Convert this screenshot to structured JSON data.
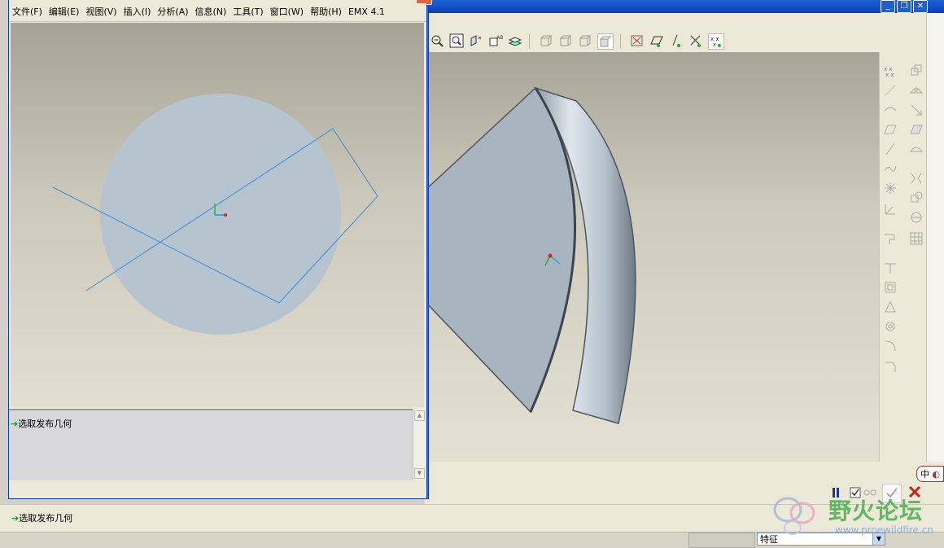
{
  "front_window": {
    "menu": [
      {
        "label": "文件(F)"
      },
      {
        "label": "编辑(E)"
      },
      {
        "label": "视图(V)"
      },
      {
        "label": "插入(I)"
      },
      {
        "label": "分析(A)"
      },
      {
        "label": "信息(N)"
      },
      {
        "label": "工具(T)"
      },
      {
        "label": "窗口(W)"
      },
      {
        "label": "帮助(H)"
      },
      {
        "label": "EMX 4.1"
      }
    ],
    "message": "选取发布几何"
  },
  "main_window": {
    "message": "选取发布几何",
    "filter_value": "特征",
    "ime_label": "中"
  },
  "watermark": {
    "text": "野火论坛",
    "url": "www.proewildfire.cn"
  },
  "colors": {
    "titlebar": "#0a3fb3",
    "part_surface": "#a8b4bf",
    "sketch_line": "#3a8fd8",
    "watermark_text": "#4caf50"
  }
}
